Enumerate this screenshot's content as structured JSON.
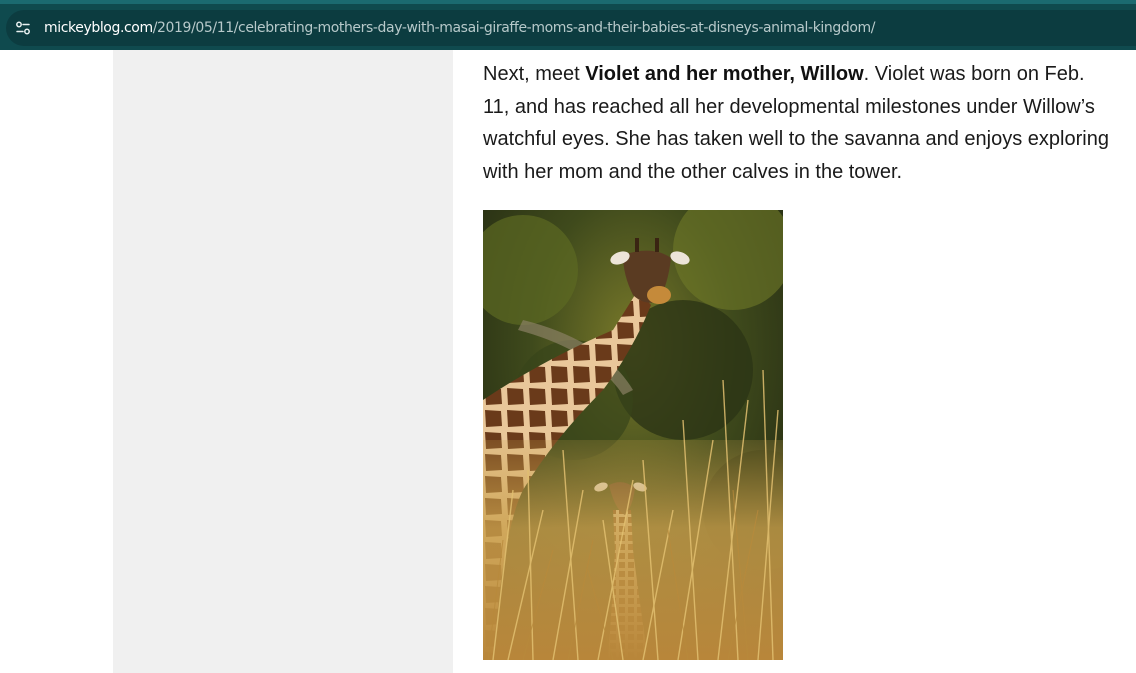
{
  "browser": {
    "url_domain": "mickeyblog.com",
    "url_path": "/2019/05/11/celebrating-mothers-day-with-masai-giraffe-moms-and-their-babies-at-disneys-animal-kingdom/",
    "site_info_icon": "tune-icon",
    "colors": {
      "toolbar": "#0f4a4e",
      "urlbar": "#0c3c40"
    }
  },
  "article": {
    "intro": "Next, meet ",
    "bold": "Violet and her mother, Willow",
    "rest": ". Violet was born on Feb. 11, and has reached all her developmental milestones under Willow’s watchful eyes. She has taken well to the savanna and enjoys exploring with her mom and the other calves in the tower."
  },
  "photo": {
    "subject": "giraffe-mother-and-calf-photo"
  }
}
